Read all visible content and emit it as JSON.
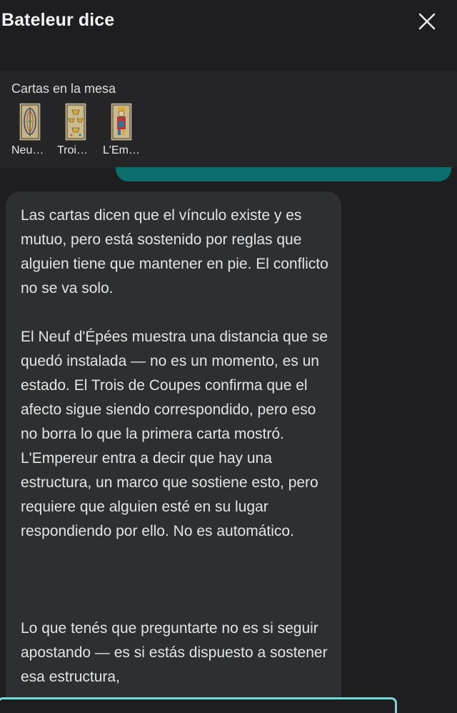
{
  "header": {
    "title": "Bateleur dice"
  },
  "table": {
    "label": "Cartas en la mesa",
    "cards": [
      {
        "label": "Neu…"
      },
      {
        "label": "Troi…"
      },
      {
        "label": "L'Em…"
      }
    ]
  },
  "message": {
    "paragraphs": [
      "Las cartas dicen que el vínculo existe y es mutuo, pero está sostenido por reglas que alguien tiene que mantener en pie. El conflicto no se va solo.",
      "El Neuf d'Épées muestra una distancia que se quedó instalada — no es un momento, es un estado. El Trois de Coupes confirma que el afecto sigue siendo correspondido, pero eso no borra lo que la primera carta mostró. L'Empereur entra a decir que hay una estructura, un marco que sostiene esto, pero requiere que alguien esté en su lugar respondiendo por ello. No es automático.",
      "Lo que tenés que preguntarte no es si seguir apostando — es si estás dispuesto a sostener esa estructura,"
    ]
  },
  "colors": {
    "background": "#1e1e20",
    "panel": "#252527",
    "bubble": "#2d2f31",
    "accent_teal": "#0d6e6e",
    "input_border": "#7fd6d6"
  },
  "icons": {
    "close": "close-icon"
  }
}
